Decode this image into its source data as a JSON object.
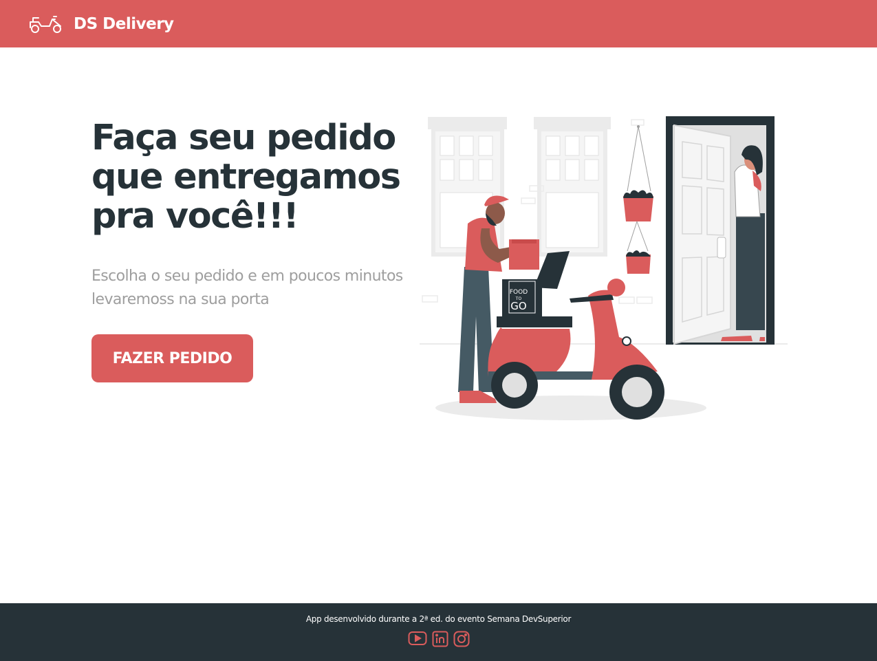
{
  "navbar": {
    "brand_name": "DS Delivery",
    "logo_icon": "scooter-icon",
    "background_color": "#DA5C5C"
  },
  "hero": {
    "title": "Faça seu pedido que entregamos pra você!!!",
    "subtitle": "Escolha o seu pedido e em poucos minutos levaremoss na sua porta",
    "cta_label": "FAZER PEDIDO",
    "illustration": {
      "icon": "food-delivery-illustration",
      "box_text_top": "FOOD",
      "box_text_mid": "TO",
      "box_text_bottom": "GO"
    }
  },
  "footer": {
    "text": "App desenvolvido durante a 2ª ed. do evento Semana DevSuperior",
    "social": [
      {
        "icon": "youtube-icon"
      },
      {
        "icon": "linkedin-icon"
      },
      {
        "icon": "instagram-icon"
      }
    ],
    "background_color": "#263238",
    "icon_color": "#DA5C5C"
  }
}
